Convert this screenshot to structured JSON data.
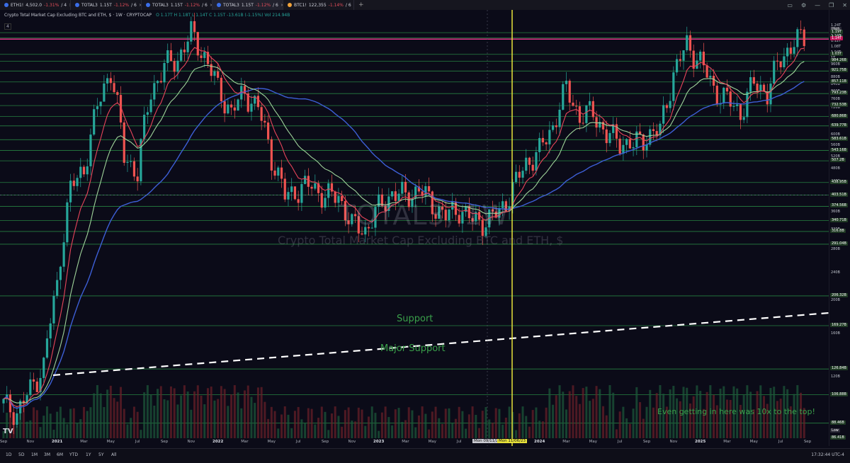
{
  "tabs": [
    {
      "symbol": "ETH1!",
      "price": "4,502.0",
      "change": "-1.31%",
      "tail": "/ 4"
    },
    {
      "symbol": "TOTAL3",
      "price": "1.15T",
      "change": "-1.12%",
      "tail": "/ 6"
    },
    {
      "symbol": "TOTAL3",
      "price": "1.15T",
      "change": "-1.12%",
      "tail": "/ 6"
    },
    {
      "symbol": "TOTAL3",
      "price": "1.15T",
      "change": "-1.12%",
      "tail": "/ 6"
    },
    {
      "symbol": "BTC1!",
      "price": "122,355",
      "change": "-1.14%",
      "tail": "/ 6"
    }
  ],
  "new_tab": "+",
  "header": {
    "title": "Crypto Total Market Cap Excluding BTC and ETH, $ · 1W · CRYPTOCAP",
    "ohlc": [
      "O",
      "1.17T",
      "H",
      "1.18T",
      "L",
      "1.14T",
      "C",
      "1.15T",
      "-13.61B (-1.15%)",
      "Vol",
      "214.94B"
    ],
    "indicator_count": "4"
  },
  "watermark": {
    "symbol": "TOTAL3, 1W",
    "description": "Crypto Total Market Cap Excluding BTC and ETH, $"
  },
  "annotations": {
    "support": "Support",
    "major_support": "Major Support",
    "note": "Even getting in here was 10x to the top!"
  },
  "price_axis": {
    "labels": [
      "1.24T",
      "1.20T",
      "1.16T",
      "1.12T",
      "1.08T",
      "1.04T",
      "1T",
      "960B",
      "920B",
      "880B",
      "840B",
      "800B",
      "760B",
      "720B",
      "680B",
      "640B",
      "600B",
      "560B",
      "520B",
      "480B",
      "440B",
      "400B",
      "360B",
      "320B",
      "280B",
      "240B",
      "200B",
      "160B",
      "120B",
      "80B",
      "40B"
    ],
    "tags": [
      {
        "text": "High",
        "color": "#2a2a36"
      },
      {
        "text": "1.19T",
        "color": "#1f3a24"
      },
      {
        "text": "1.15T",
        "color": "#1f3a24"
      },
      {
        "text": "1.14T",
        "color": "#c2185b"
      },
      {
        "text": "1.03T",
        "color": "#1f3a24"
      },
      {
        "text": "984.26B",
        "color": "#1f3a24"
      },
      {
        "text": "921.75B",
        "color": "#1f3a24"
      },
      {
        "text": "857.11B",
        "color": "#1f3a24"
      },
      {
        "text": "793.23B",
        "color": "#1f3a24"
      },
      {
        "text": "732.53B",
        "color": "#1f3a24"
      },
      {
        "text": "680.86B",
        "color": "#1f3a24"
      },
      {
        "text": "639.77B",
        "color": "#1f3a24"
      },
      {
        "text": "583.61B",
        "color": "#1f3a24"
      },
      {
        "text": "543.16B",
        "color": "#1f3a24"
      },
      {
        "text": "507.2B",
        "color": "#1f3a24"
      },
      {
        "text": "438.95B",
        "color": "#1f3a24"
      },
      {
        "text": "403.51B",
        "color": "#1f3a24"
      },
      {
        "text": "374.56B",
        "color": "#1f3a24"
      },
      {
        "text": "340.71B",
        "color": "#1f3a24"
      },
      {
        "text": "316.8B",
        "color": "#1f3a24"
      },
      {
        "text": "291.04B",
        "color": "#1f3a24"
      },
      {
        "text": "206.32B",
        "color": "#1f3a24"
      },
      {
        "text": "169.27B",
        "color": "#1f3a24"
      },
      {
        "text": "126.84B",
        "color": "#1f3a24"
      },
      {
        "text": "106.88B",
        "color": "#1f3a24"
      },
      {
        "text": "88.46B",
        "color": "#1f3a24"
      },
      {
        "text": "Low",
        "color": "#2a2a36"
      },
      {
        "text": "86.41B",
        "color": "#1f3a24"
      }
    ]
  },
  "time_axis": {
    "labels": [
      {
        "t": "Sep",
        "year": false
      },
      {
        "t": "Nov",
        "year": false
      },
      {
        "t": "2021",
        "year": true
      },
      {
        "t": "Mar",
        "year": false
      },
      {
        "t": "May",
        "year": false
      },
      {
        "t": "Jul",
        "year": false
      },
      {
        "t": "Sep",
        "year": false
      },
      {
        "t": "Nov",
        "year": false
      },
      {
        "t": "2022",
        "year": true
      },
      {
        "t": "Mar",
        "year": false
      },
      {
        "t": "May",
        "year": false
      },
      {
        "t": "Jul",
        "year": false
      },
      {
        "t": "Sep",
        "year": false
      },
      {
        "t": "Nov",
        "year": false
      },
      {
        "t": "2023",
        "year": true
      },
      {
        "t": "Mar",
        "year": false
      },
      {
        "t": "May",
        "year": false
      },
      {
        "t": "Jul",
        "year": false
      },
      {
        "t": "2024",
        "year": true
      },
      {
        "t": "Mar",
        "year": false
      },
      {
        "t": "May",
        "year": false
      },
      {
        "t": "Jul",
        "year": false
      },
      {
        "t": "Sep",
        "year": false
      },
      {
        "t": "Nov",
        "year": false
      },
      {
        "t": "2025",
        "year": true
      },
      {
        "t": "Mar",
        "year": false
      },
      {
        "t": "May",
        "year": false
      },
      {
        "t": "Jul",
        "year": false
      },
      {
        "t": "Sep",
        "year": false
      }
    ],
    "cursor_left": "Mon 09/11/23",
    "cursor_right": "Mon 11/06/23"
  },
  "ranges": [
    "1D",
    "5D",
    "1M",
    "3M",
    "6M",
    "YTD",
    "1Y",
    "5Y",
    "All"
  ],
  "clock": "17:32:44 UTC-4",
  "logo": "TV",
  "colors": {
    "up": "#26a69a",
    "down": "#ef5350",
    "green_line": "#2fa84f",
    "magenta": "#e0338a",
    "ema_red": "#e8455a",
    "ema_green": "#9fd39a",
    "sma_blue": "#3d5fd6",
    "cursor": "#e8e23a",
    "bg": "#0b0b18"
  },
  "chart_data": {
    "type": "candlestick",
    "title": "TOTAL3, 1W",
    "ylabel": "",
    "yscale": "log",
    "ylim": [
      80,
      1260
    ],
    "series_approx_weekly_close": [
      [
        "2020-09",
        100
      ],
      [
        "2020-10",
        95
      ],
      [
        "2020-11",
        110
      ],
      [
        "2020-12",
        130
      ],
      [
        "2021-01",
        220
      ],
      [
        "2021-02",
        420
      ],
      [
        "2021-03",
        480
      ],
      [
        "2021-04",
        720
      ],
      [
        "2021-05",
        930
      ],
      [
        "2021-06",
        520
      ],
      [
        "2021-07",
        470
      ],
      [
        "2021-08",
        800
      ],
      [
        "2021-09",
        950
      ],
      [
        "2021-10",
        1000
      ],
      [
        "2021-11",
        1180
      ],
      [
        "2021-12",
        1020
      ],
      [
        "2022-01",
        820
      ],
      [
        "2022-02",
        700
      ],
      [
        "2022-03",
        800
      ],
      [
        "2022-04",
        720
      ],
      [
        "2022-05",
        520
      ],
      [
        "2022-06",
        400
      ],
      [
        "2022-07",
        420
      ],
      [
        "2022-08",
        430
      ],
      [
        "2022-09",
        400
      ],
      [
        "2022-10",
        400
      ],
      [
        "2022-11",
        330
      ],
      [
        "2022-12",
        320
      ],
      [
        "2023-01",
        370
      ],
      [
        "2023-02",
        410
      ],
      [
        "2023-03",
        400
      ],
      [
        "2023-04",
        420
      ],
      [
        "2023-05",
        380
      ],
      [
        "2023-06",
        350
      ],
      [
        "2023-07",
        370
      ],
      [
        "2023-08",
        340
      ],
      [
        "2023-09",
        340
      ],
      [
        "2023-10",
        360
      ],
      [
        "2023-11",
        420
      ],
      [
        "2023-12",
        500
      ],
      [
        "2024-01",
        540
      ],
      [
        "2024-02",
        640
      ],
      [
        "2024-03",
        820
      ],
      [
        "2024-04",
        680
      ],
      [
        "2024-05",
        700
      ],
      [
        "2024-06",
        600
      ],
      [
        "2024-07",
        580
      ],
      [
        "2024-08",
        560
      ],
      [
        "2024-09",
        600
      ],
      [
        "2024-10",
        620
      ],
      [
        "2024-11",
        900
      ],
      [
        "2024-12",
        1100
      ],
      [
        "2025-01",
        980
      ],
      [
        "2025-02",
        820
      ],
      [
        "2025-03",
        760
      ],
      [
        "2025-04",
        700
      ],
      [
        "2025-05",
        850
      ],
      [
        "2025-06",
        800
      ],
      [
        "2025-07",
        1000
      ],
      [
        "2025-08",
        1120
      ],
      [
        "2025-09",
        1150
      ]
    ],
    "horizontal_levels_green": [
      1190,
      1150,
      1030,
      984.26,
      921.75,
      857.11,
      793.23,
      732.53,
      680.86,
      639.77,
      583.61,
      543.16,
      507.2,
      438.95,
      403.51,
      374.56,
      340.71,
      316.8,
      291.04,
      206.32,
      169.27,
      126.84,
      106.88,
      88.46
    ],
    "horizontal_level_magenta": 1140,
    "cursor_date": "2023-11-06"
  }
}
